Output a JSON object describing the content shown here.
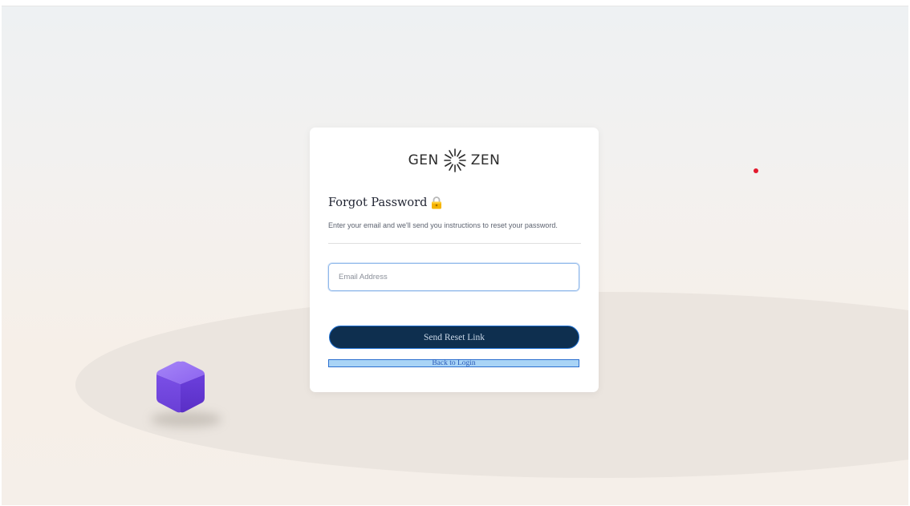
{
  "brand": {
    "left_text": "GEN",
    "right_text": "ZEN",
    "icon": "sunburst-logo-icon"
  },
  "form": {
    "title": "Forgot Password",
    "title_icon": "lock-icon",
    "subtitle": "Enter your email and we'll send you instructions to reset your password.",
    "email_placeholder": "Email Address",
    "email_value": "",
    "submit_label": "Send Reset Link",
    "back_label": "Back to Login"
  },
  "colors": {
    "button_bg": "#0e2f4f",
    "link_highlight": "#a9d4f6",
    "cube": "#7b4fe0",
    "marker": "#e2192d"
  }
}
